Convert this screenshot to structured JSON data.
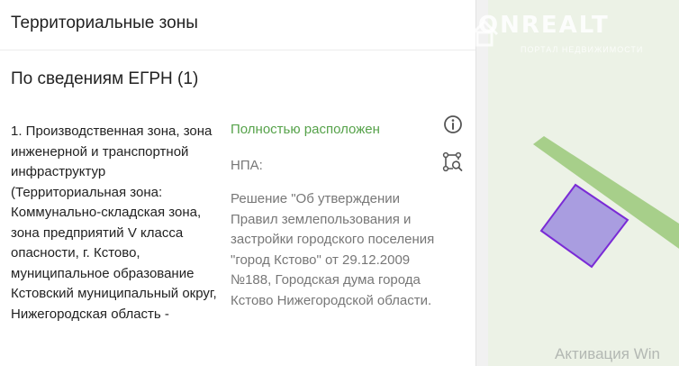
{
  "panel": {
    "title": "Территориальные зоны",
    "section_title": "По сведениям ЕГРН (1)"
  },
  "zone": {
    "name": "1. Производственная зона, зона инженерной и транспортной инфраструктур (Территориальная зона: Коммунально-складская зона, зона предприятий V класса опасности, г. Кстово, муниципальное образование Кстовский муниципальный округ, Нижегородская область -",
    "status": "Полностью расположен",
    "npa_label": "НПА:",
    "npa_text": "Решение \"Об утверждении Правил землепользования и застройки городского поселения \"город Кстово\" от 29.12.2009 №188, Городская дума города Кстово Нижегородской области.",
    "status_color": "#56a24a"
  },
  "icons": {
    "info": "info-icon",
    "geometry": "polygon-search-icon"
  },
  "map": {
    "road_color": "#a7cf8a",
    "parcel_fill": "#a99de0",
    "parcel_stroke": "#7a2bd6"
  },
  "watermark": {
    "brand": "ONREALT",
    "tagline": "ПОРТАЛ НЕДВИЖИМОСТИ"
  },
  "system_overlay": {
    "activation_text": "Активация Win"
  }
}
